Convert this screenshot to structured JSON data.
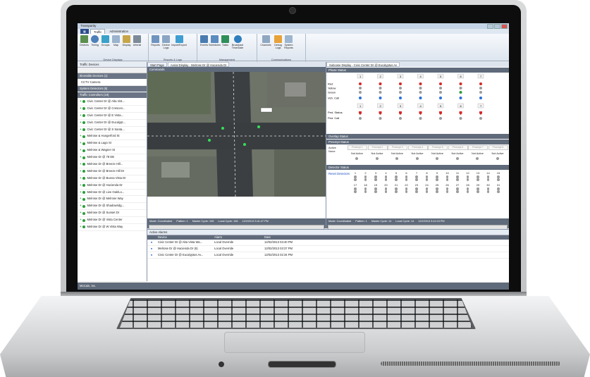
{
  "app": {
    "title": "Transparity",
    "company": "McCain, Inc."
  },
  "menu": {
    "tabs": [
      "Traffic",
      "Administration"
    ]
  },
  "ribbon": {
    "groups": [
      {
        "label": "Device Displays",
        "buttons": [
          "Devices",
          "Timing",
          "Groups",
          "Map",
          "Display",
          "Arterial"
        ]
      },
      {
        "label": "Reports & Logs",
        "buttons": [
          "Reports",
          "Device Logs",
          "Import/Export"
        ]
      },
      {
        "label": "Management",
        "buttons": [
          "Events",
          "Schedules",
          "Tasks",
          "Broadcast Time/Date"
        ]
      },
      {
        "label": "Communications",
        "buttons": [
          "Channels",
          "Debug Logs",
          "System Reports"
        ]
      }
    ]
  },
  "left_pane": {
    "title": "Traffic Devices",
    "groups": [
      {
        "label": "Itinerable Devices (1)",
        "items": [
          "CCTV Camera"
        ]
      },
      {
        "label": "System Detectors (6)",
        "items": []
      },
      {
        "label": "Traffic Controllers (19)",
        "items": [
          "Civic Center Dr @ Alta Vist...",
          "Civic Center Dr @ Crescen...",
          "Civic Center Dr @ E Vista...",
          "Civic Center Dr @ Eucalypt...",
          "Civic Center Dr @ S Santa...",
          "Melrose & Hungerford St",
          "Melrose & Lago St",
          "Melrose & Wagner St",
          "Melrose Dr @ 78 EB",
          "Melrose Dr @ Breeze Hill...",
          "Melrose Dr @ Breeze Hill Dr",
          "Melrose Dr @ Buena Vista Dr",
          "Melrose Dr @ Hacienda Dr",
          "Melrose Dr @ Live Oak/Lo...",
          "Melrose Dr @ Melrose Way",
          "Melrose Dr @ Shadowridg...",
          "Melrose Dr @ Sunset Dr",
          "Melrose Dr @ Vista Center",
          "Melrose Dr @ W Vista Way"
        ]
      }
    ]
  },
  "center_pane": {
    "tabs": [
      "Start Page",
      "Aerial Display - Melrose Dr @ Hacienda Dr"
    ],
    "commands": "Commands",
    "status": {
      "mode": "Mode: Coordinated",
      "pattern": "Pattern: 1",
      "master": "Master Cycle: 106",
      "local": "Local Cycle: 106",
      "time": "12/2/2013 3:41:47 PM"
    }
  },
  "right_pane": {
    "tab": "Subcase Display - Civic Center Dr @ Eucalyptus Av",
    "sections": [
      "Phase Status",
      "Overlap Status",
      "Preempt Status",
      "Detector Status"
    ],
    "phase_numbers": [
      "1",
      "2",
      "3",
      "4",
      "5",
      "6",
      "7"
    ],
    "row_labels": [
      "Red",
      "Yellow",
      "Green",
      "Veh. Call",
      "Ped. Status",
      "Ped. Call"
    ],
    "preempt": {
      "active_label": "Active",
      "none_label": "None",
      "slots": [
        "Preempt 1",
        "Preempt 2",
        "Preempt 3",
        "Preempt 4",
        "Preempt 5",
        "Preempt 6",
        "Preempt 7",
        "Preempt 8"
      ],
      "state": "Not Active"
    },
    "detectors": {
      "reset": "Reset Detectors",
      "row1": [
        "1",
        "2",
        "3",
        "4",
        "5",
        "6",
        "7",
        "8",
        "9",
        "10",
        "11",
        "12",
        "13",
        "14",
        "15"
      ],
      "row2": [
        "17",
        "18",
        "19",
        "20",
        "21",
        "22",
        "23",
        "24",
        "25",
        "26",
        "27",
        "28",
        "29",
        "30",
        "31"
      ]
    },
    "status": {
      "mode": "Mode: Coordinated",
      "pattern": "Pattern: 1",
      "master": "Master Cycle: 14",
      "local": "Local Cycle: 14",
      "time": "12/2/2013 3:42:15 PM"
    }
  },
  "alarms": {
    "title": "Active Alarms",
    "columns": [
      "Device",
      "Alarm",
      "Date"
    ],
    "rows": [
      {
        "device": "Civic Center Dr @ Alta Vista Wa...",
        "alarm": "Local Override",
        "date": "12/02/2013 03:40 PM"
      },
      {
        "device": "Melrose Dr @ Hacienda Dr (6)",
        "alarm": "Local Override",
        "date": "12/02/2013 03:37 PM"
      },
      {
        "device": "Civic Center Dr @ Eucalyptus Av...",
        "alarm": "Local Override",
        "date": "12/02/2013 02:34 PM"
      }
    ]
  }
}
